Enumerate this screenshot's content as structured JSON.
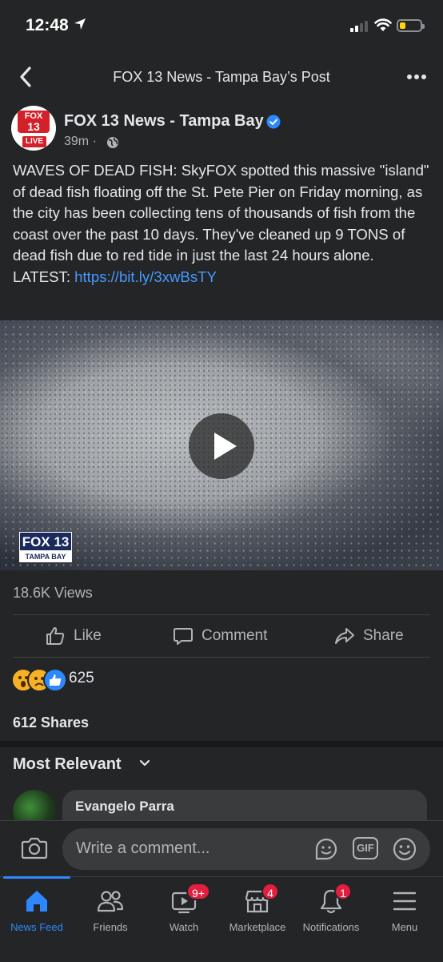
{
  "status_bar": {
    "time": "12:48",
    "battery_level": 0.3
  },
  "nav": {
    "title": "FOX 13 News - Tampa Bay’s Post"
  },
  "post": {
    "page_name": "FOX 13 News - Tampa Bay",
    "avatar_text": {
      "logo_line1": "FOX",
      "logo_line2": "13",
      "live": "LIVE"
    },
    "time_ago": "39m",
    "meta_sep": "·",
    "body": "WAVES OF DEAD FISH: SkyFOX spotted this massive \"island\" of dead fish floating off the St. Pete Pier on Friday morning, as the city has been collecting tens of thousands of fish from the coast over the past 10 days. They've cleaned up 9 TONS of dead fish due to red tide in just the last 24 hours alone. LATEST: ",
    "link": "https://bit.ly/3xwBsTY",
    "video_watermark": {
      "line1": "FOX 13",
      "line2": "TAMPA BAY"
    },
    "views": "18.6K Views",
    "actions": {
      "like": "Like",
      "comment": "Comment",
      "share": "Share"
    },
    "reaction_count": "625",
    "shares": "612 Shares"
  },
  "comments": {
    "sort_label": "Most Relevant",
    "first_comment": {
      "author": "Evangelo Parra"
    }
  },
  "composer": {
    "placeholder": "Write a comment...",
    "gif_label": "GIF"
  },
  "tabbar": {
    "tabs": [
      {
        "label": "News Feed",
        "icon": "home-icon",
        "active": true
      },
      {
        "label": "Friends",
        "icon": "friends-icon"
      },
      {
        "label": "Watch",
        "icon": "watch-icon",
        "badge": "9+"
      },
      {
        "label": "Marketplace",
        "icon": "marketplace-icon",
        "badge": "4"
      },
      {
        "label": "Notifications",
        "icon": "bell-icon",
        "badge": "1"
      },
      {
        "label": "Menu",
        "icon": "hamburger-icon"
      }
    ]
  },
  "colors": {
    "accent": "#2d88ff",
    "background": "#242526",
    "badge": "#e41e3f",
    "link": "#4599ff"
  }
}
